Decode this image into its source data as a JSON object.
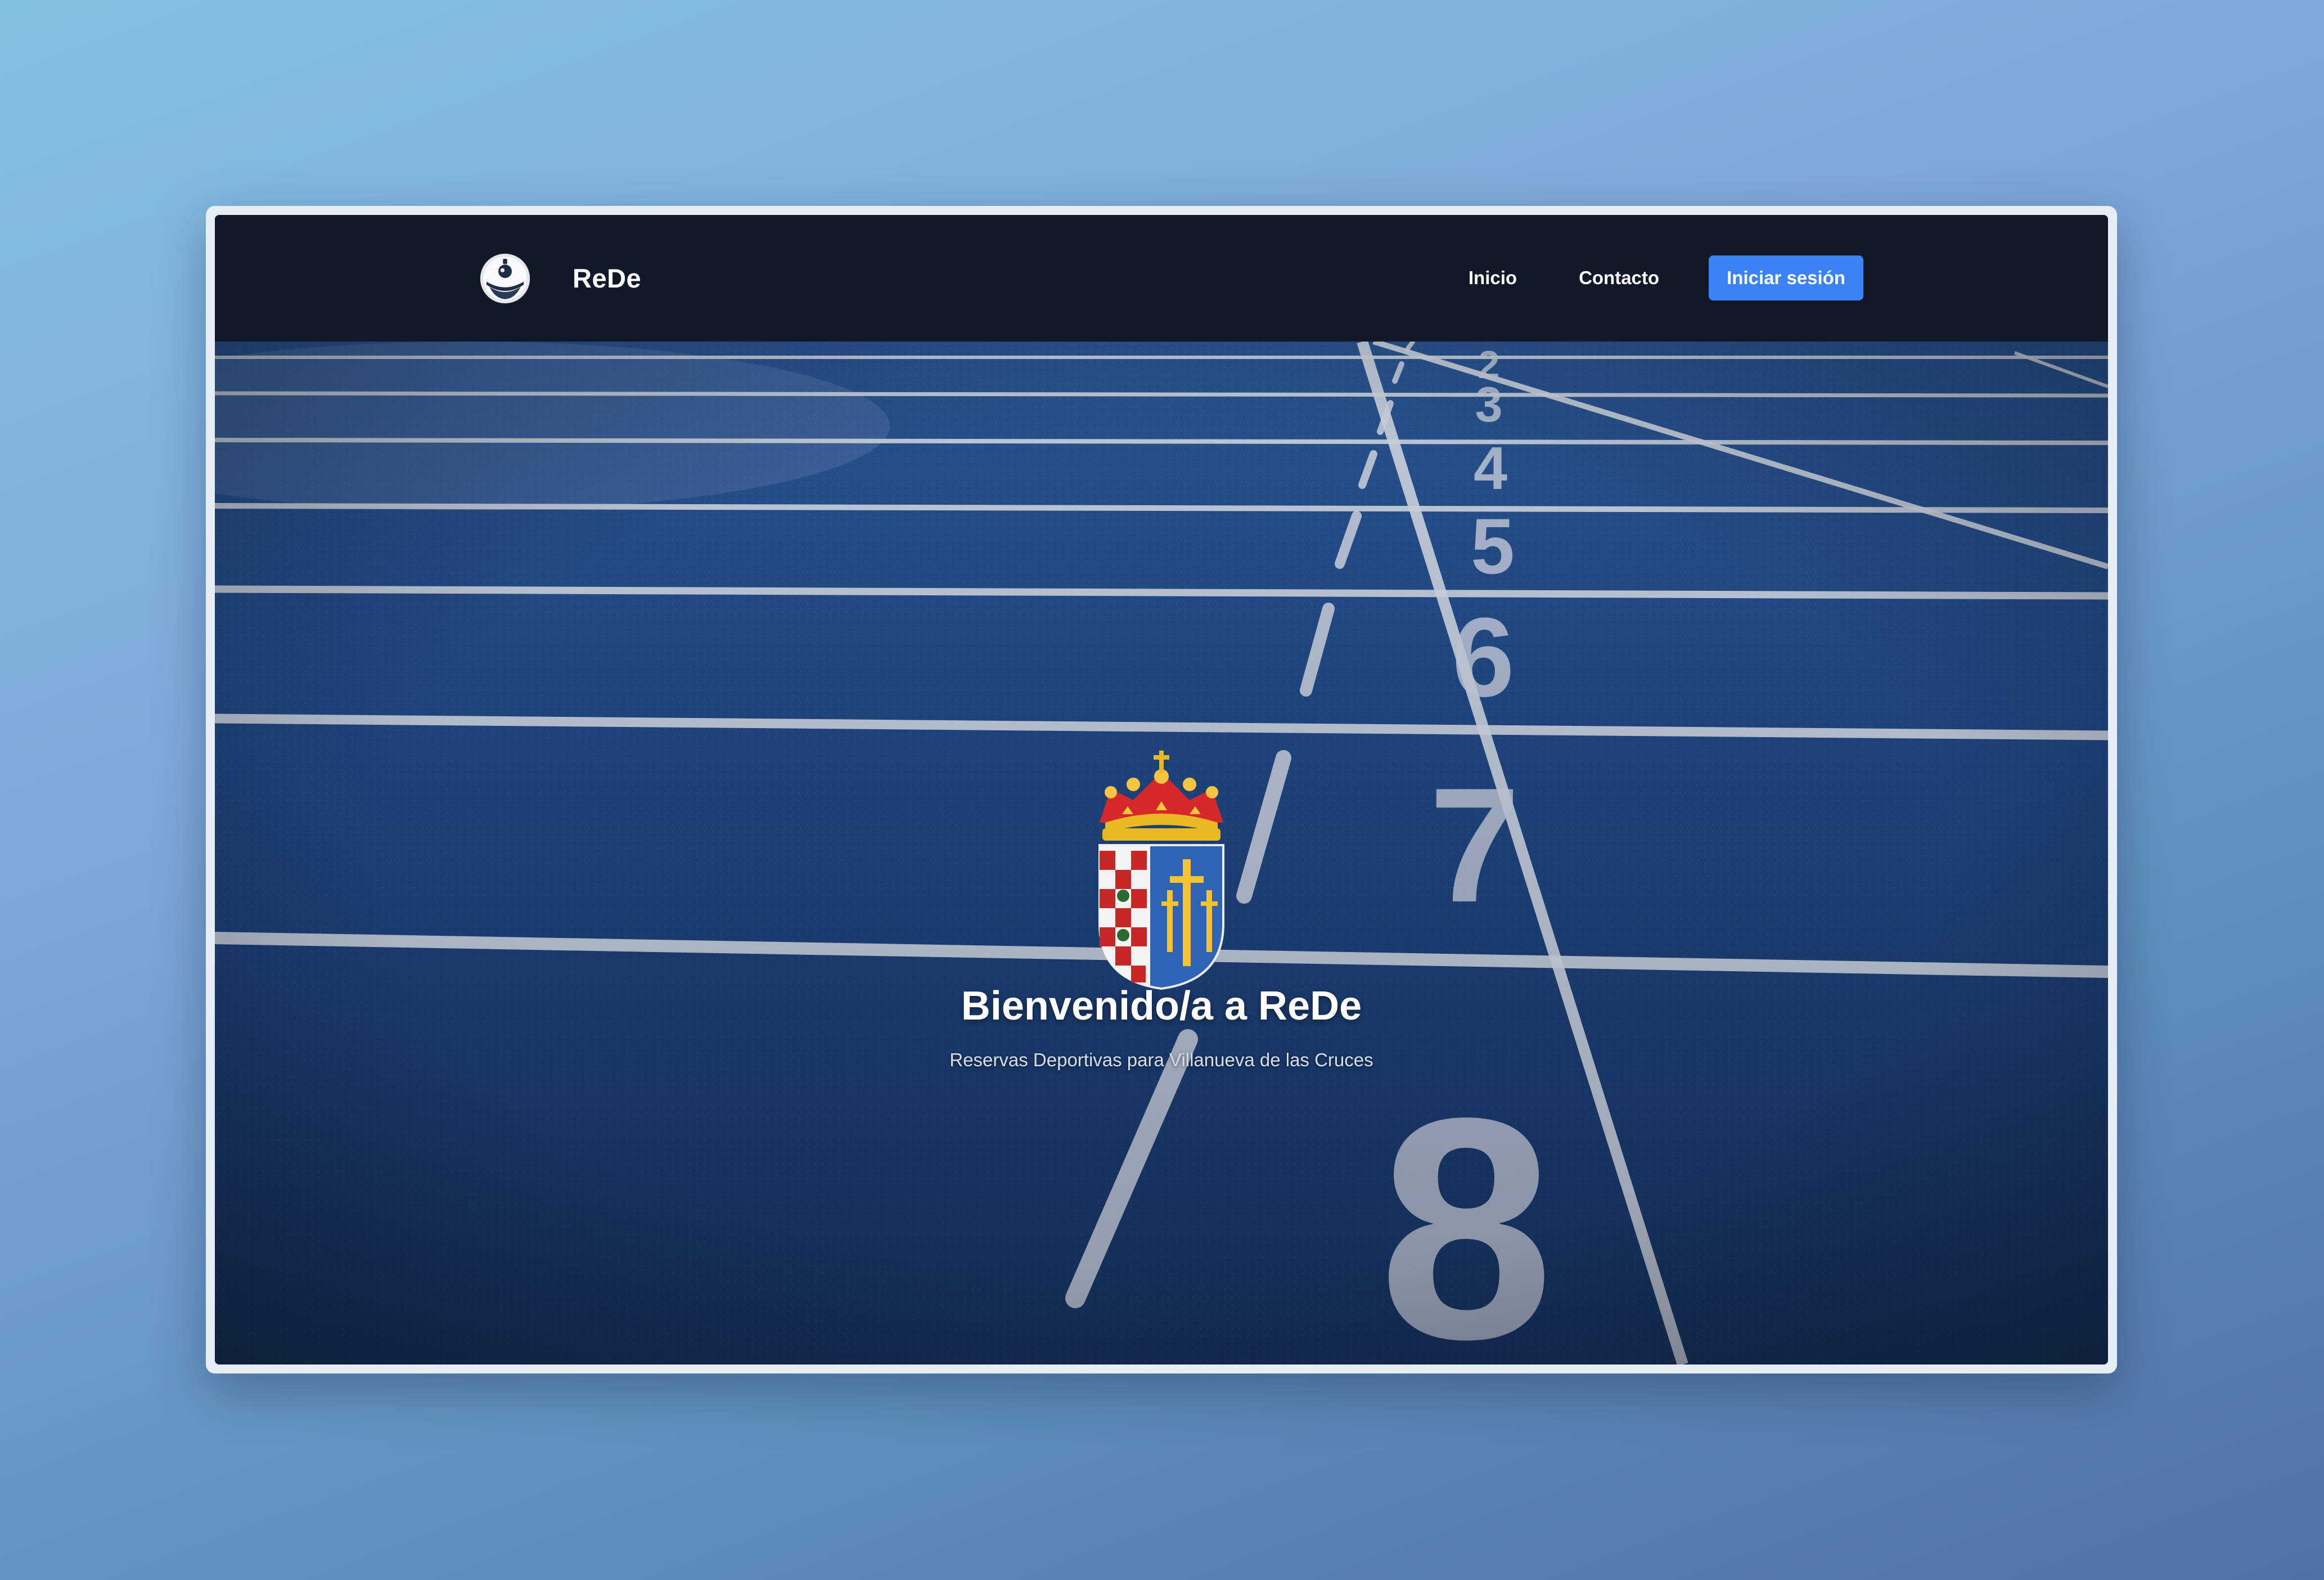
{
  "navbar": {
    "brand_name": "ReDe",
    "logo_icon": "rede-logo-icon",
    "links": [
      {
        "label": "Inicio"
      },
      {
        "label": "Contacto"
      }
    ],
    "login_label": "Iniciar sesión"
  },
  "hero": {
    "background": "running-track-photo",
    "lane_numbers": [
      "2",
      "3",
      "4",
      "5",
      "6",
      "7",
      "8"
    ],
    "crest_icon": "municipal-coat-of-arms-icon",
    "title": "Bienvenido/a a ReDe",
    "subtitle": "Reservas Deportivas para Villanueva de las Cruces"
  },
  "colors": {
    "navbar_bg": "#111827",
    "accent": "#3b82f6",
    "track_blue": "#1f4c8f",
    "page_bg_top": "#84c0e0",
    "page_bg_bottom": "#4f72a6"
  }
}
